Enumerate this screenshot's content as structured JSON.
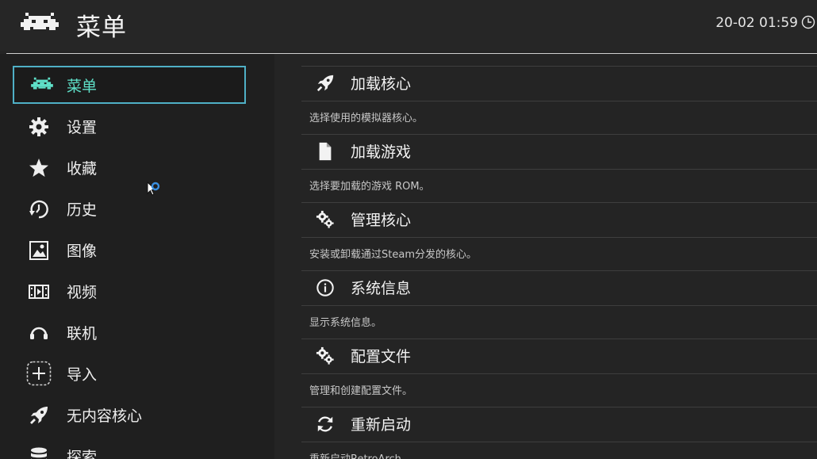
{
  "header": {
    "title": "菜单",
    "clock": "20-02 01:59"
  },
  "sidebar": {
    "items": [
      {
        "label": "菜单",
        "icon": "retroarch-invader-icon",
        "active": true
      },
      {
        "label": "设置",
        "icon": "gear-icon"
      },
      {
        "label": "收藏",
        "icon": "star-icon"
      },
      {
        "label": "历史",
        "icon": "history-icon"
      },
      {
        "label": "图像",
        "icon": "image-icon"
      },
      {
        "label": "视频",
        "icon": "film-icon"
      },
      {
        "label": "联机",
        "icon": "netplay-headset-icon"
      },
      {
        "label": "导入",
        "icon": "add-plus-icon"
      },
      {
        "label": "无内容核心",
        "icon": "rocket-icon"
      },
      {
        "label": "探索",
        "icon": "database-icon"
      }
    ]
  },
  "main": {
    "entries": [
      {
        "label": "加载核心",
        "sub": "选择使用的模拟器核心。",
        "icon": "rocket-icon"
      },
      {
        "label": "加载游戏",
        "sub": "选择要加载的游戏 ROM。",
        "icon": "file-icon"
      },
      {
        "label": "管理核心",
        "sub": "安装或卸载通过Steam分发的核心。",
        "icon": "gears-icon"
      },
      {
        "label": "系统信息",
        "sub": "显示系统信息。",
        "icon": "info-icon"
      },
      {
        "label": "配置文件",
        "sub": "管理和创建配置文件。",
        "icon": "gears-icon"
      },
      {
        "label": "重新启动",
        "sub": "重新启动RetroArch。",
        "icon": "restart-icon"
      }
    ]
  },
  "colors": {
    "accent": "#4fb0c6",
    "active_text": "#5fe0c8",
    "background": "#242424",
    "sidebar_background": "#1f1f1f"
  }
}
